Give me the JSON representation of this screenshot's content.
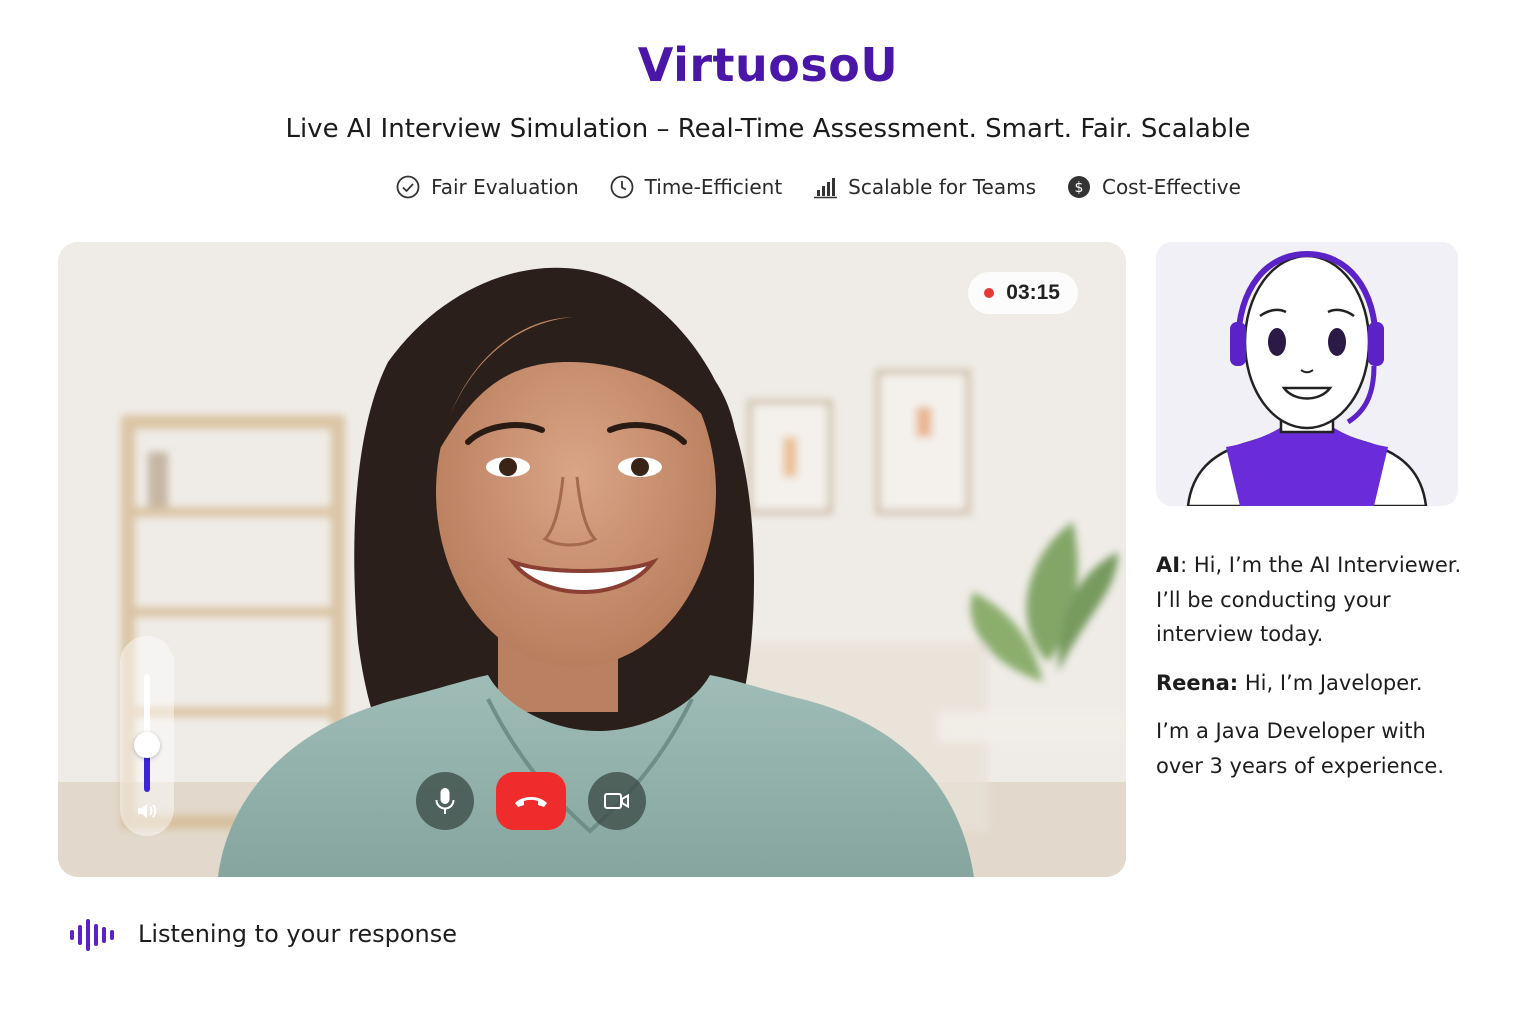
{
  "header": {
    "brand": "VirtuosoU",
    "tagline": "Live AI Interview Simulation – Real-Time Assessment. Smart. Fair. Scalable"
  },
  "features": [
    {
      "label": "Fair Evaluation",
      "icon": "check-circle-icon"
    },
    {
      "label": "Time-Efficient",
      "icon": "clock-icon"
    },
    {
      "label": "Scalable for Teams",
      "icon": "bar-chart-icon"
    },
    {
      "label": "Cost-Effective",
      "icon": "dollar-coin-icon"
    }
  ],
  "video": {
    "timer": "03:15",
    "volume_level": 0.4,
    "controls": [
      {
        "name": "mute-button",
        "icon": "microphone-icon"
      },
      {
        "name": "end-call-button",
        "icon": "phone-hangup-icon"
      },
      {
        "name": "camera-button",
        "icon": "video-camera-icon"
      }
    ]
  },
  "transcript": [
    {
      "speaker": "AI",
      "text": ": Hi, I’m the AI Interviewer. I’ll be conducting your interview today."
    },
    {
      "speaker": "Reena:",
      "text": " Hi, I’m Javeloper."
    },
    {
      "speaker": "",
      "text": "I’m a Java Developer with over 3 years of experience."
    }
  ],
  "status": {
    "text": "Listening to your response",
    "icon": "sound-wave-icon"
  },
  "colors": {
    "brand": "#4a16a8",
    "end_call": "#ef2b2b",
    "record": "#e53935",
    "volume_fill": "#3a25d6",
    "avatar_purple": "#6a2bd9"
  }
}
